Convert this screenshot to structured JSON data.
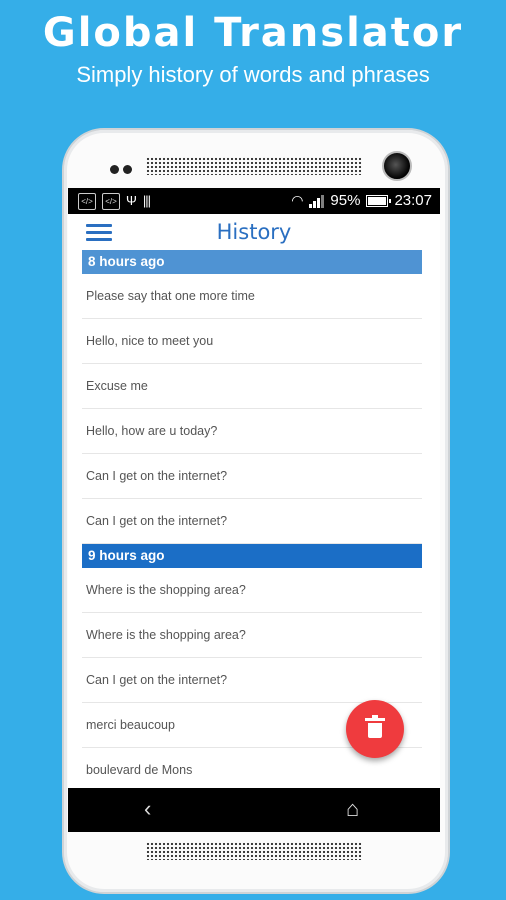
{
  "promo": {
    "title": "Global Translator",
    "subtitle": "Simply history of words and phrases"
  },
  "status_bar": {
    "battery": "95%",
    "time": "23:07",
    "battery_level": 0.95
  },
  "app_bar": {
    "title": "History",
    "menu_icon": "hamburger-menu-icon"
  },
  "history": {
    "sections": [
      {
        "header": "8 hours ago",
        "items": [
          "Please say that one more time",
          "Hello,  nice to meet you",
          "Excuse me",
          "Hello, how are u today?",
          "Can I get on the internet?",
          "Can I get on the internet?"
        ]
      },
      {
        "header": "9 hours ago",
        "items": [
          "Where is the shopping area?",
          "Where is the shopping area?",
          "Can I get on the internet?",
          "merci beaucoup",
          "boulevard de Mons"
        ]
      }
    ]
  },
  "fab": {
    "icon": "trash-icon"
  },
  "nav": {
    "back_icon": "‹",
    "home_icon": "⌂"
  },
  "colors": {
    "background": "#35aee8",
    "accent": "#2a6fc1",
    "header": "#1b6ec6",
    "fab": "#ef3b3e"
  }
}
